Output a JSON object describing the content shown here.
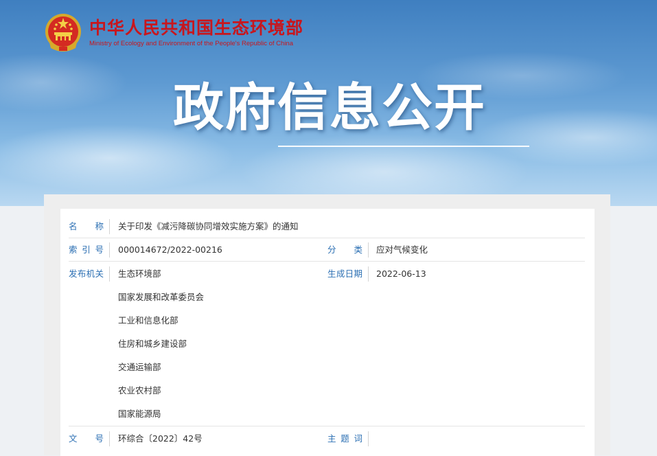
{
  "header": {
    "logo_cn": "中华人民共和国生态环境部",
    "logo_en": "Ministry of Ecology and Environment of the People's Republic of China",
    "emblem_icon": "national-emblem-icon",
    "banner_title": "政府信息公开"
  },
  "info": {
    "name_label": "名　　称",
    "name_value": "关于印发《减污降碳协同增效实施方案》的通知",
    "index_label": "索 引 号",
    "index_value": "000014672/2022-00216",
    "category_label": "分　　类",
    "category_value": "应对气候变化",
    "publisher_label": "发布机关",
    "publishers": [
      "生态环境部",
      "国家发展和改革委员会",
      "工业和信息化部",
      "住房和城乡建设部",
      "交通运输部",
      "农业农村部",
      "国家能源局"
    ],
    "date_label": "生成日期",
    "date_value": "2022-06-13",
    "doc_no_label": "文　　号",
    "doc_no_value": "环综合〔2022〕42号",
    "keywords_label": "主 题 词",
    "keywords_value": ""
  },
  "colors": {
    "brand_red": "#c8161d",
    "label_blue": "#2b6fb3",
    "banner_sky": "#5e9ad2"
  }
}
